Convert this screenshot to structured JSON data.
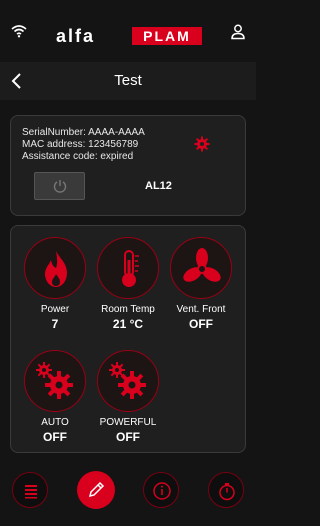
{
  "status_bar": {
    "wifi_icon": "wifi-icon",
    "user_icon": "user-icon"
  },
  "brand": {
    "left": "alfa",
    "right": "PLAM",
    "accent": "#d8001c"
  },
  "header": {
    "title": "Test"
  },
  "device": {
    "serial": "SerialNumber: AAAA-AAAA",
    "mac": "MAC address: 123456789",
    "assistance": "Assistance code: expired",
    "model": "AL12"
  },
  "controls": [
    {
      "label": "Power",
      "value": "7"
    },
    {
      "label": "Room Temp",
      "value": "21 °C"
    },
    {
      "label": "Vent. Front",
      "value": "OFF"
    },
    {
      "label": "AUTO",
      "value": "OFF"
    },
    {
      "label": "POWERFUL",
      "value": "OFF"
    }
  ],
  "bottom_nav": [
    "list-icon",
    "pencil-icon",
    "info-icon",
    "timer-icon"
  ]
}
